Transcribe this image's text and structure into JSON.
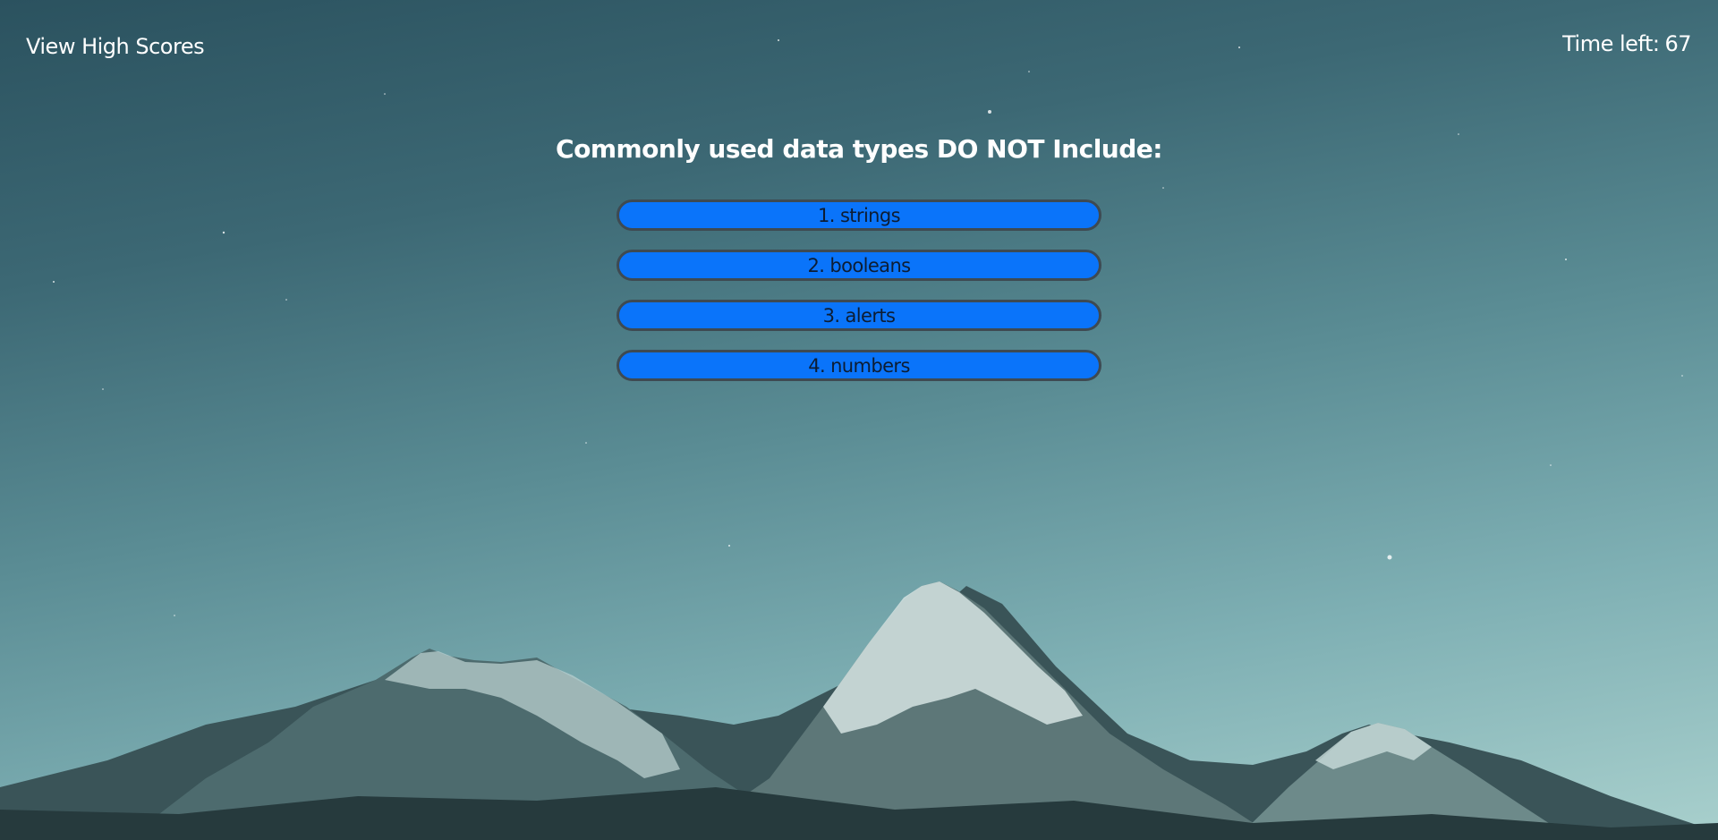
{
  "header": {
    "high_scores_link": "View High Scores",
    "timer_label": "Time left:",
    "timer_value": "67"
  },
  "quiz": {
    "question": "Commonly used data types DO NOT Include:",
    "answers": [
      "1. strings",
      "2. booleans",
      "3. alerts",
      "4. numbers"
    ]
  },
  "background": {
    "sky_top": "#2b525f",
    "sky_bottom": "#a9d0cd",
    "button_color": "#0a74fa"
  }
}
